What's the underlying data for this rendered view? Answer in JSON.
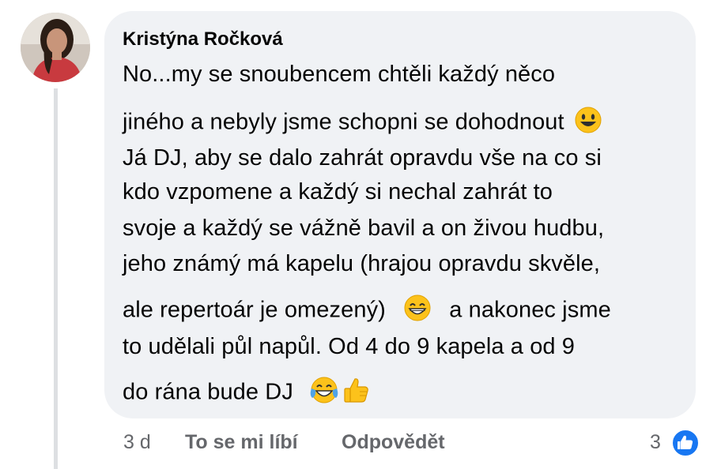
{
  "comment": {
    "author": "Kristýna Ročková",
    "lines": [
      "No...my se snoubencem chtěli každý něco",
      "jiného a nebyly jsme schopni se dohodnout",
      "Já DJ, aby se dalo zahrát opravdu vše na co si",
      "kdo vzpomene a každý si nechal zahrát to",
      "svoje a každý se vážně bavil a on živou hudbu,",
      "jeho známý má kapelu (hrajou opravdu skvěle,",
      "ale repertoár je omezený)",
      "a nakonec jsme",
      "to udělali půl napůl. Od 4 do 9 kapela a od 9",
      "do rána bude DJ"
    ],
    "emojis": [
      "smiley-face",
      "grinning-face",
      "tears-of-joy-face",
      "thumbs-up"
    ]
  },
  "footer": {
    "age": "3 d",
    "like_label": "To se mi líbí",
    "reply_label": "Odpovědět",
    "reaction_count": "3",
    "reaction_type": "like"
  },
  "colors": {
    "bubble": "#f0f2f5",
    "text": "#050505",
    "meta": "#65676b",
    "like_blue": "#1877f2"
  }
}
